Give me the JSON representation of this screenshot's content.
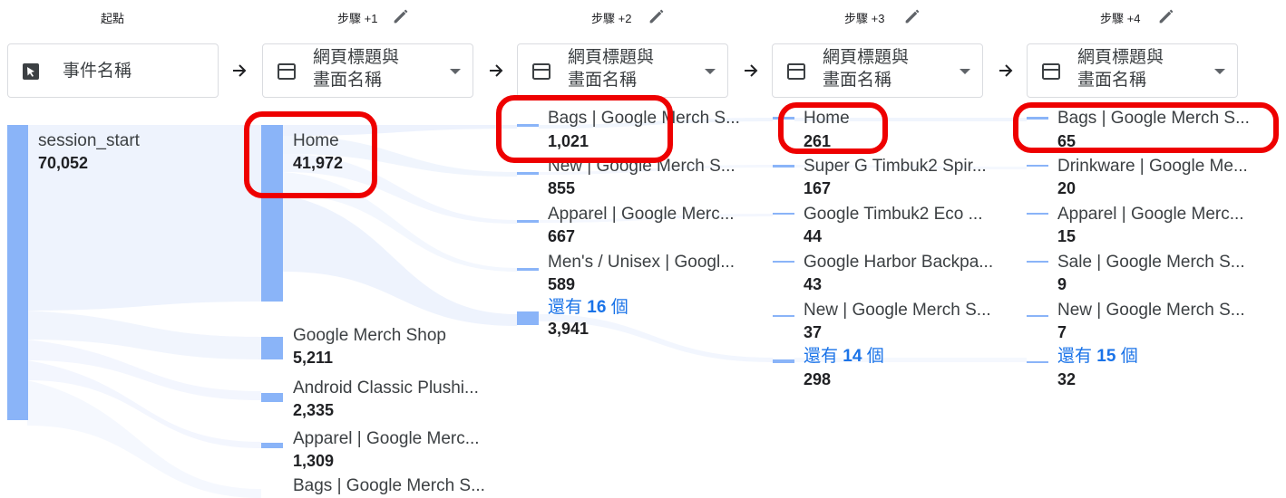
{
  "steps": [
    {
      "label": "起點"
    },
    {
      "label": "步驟 +1"
    },
    {
      "label": "步驟 +2"
    },
    {
      "label": "步驟 +3"
    },
    {
      "label": "步驟 +4"
    }
  ],
  "dropdowns": [
    {
      "line1": "事件名稱",
      "line2": ""
    },
    {
      "line1": "網頁標題與",
      "line2": "畫面名稱"
    },
    {
      "line1": "網頁標題與",
      "line2": "畫面名稱"
    },
    {
      "line1": "網頁標題與",
      "line2": "畫面名稱"
    },
    {
      "line1": "網頁標題與",
      "line2": "畫面名稱"
    }
  ],
  "col0": [
    {
      "name": "session_start",
      "value": "70,052"
    }
  ],
  "col1": [
    {
      "name": "Home",
      "value": "41,972"
    },
    {
      "name": "Google Merch Shop",
      "value": "5,211"
    },
    {
      "name": "Android Classic Plushi...",
      "value": "2,335"
    },
    {
      "name": "Apparel | Google Merc...",
      "value": "1,309"
    },
    {
      "name": "Bags | Google Merch S...",
      "value": ""
    }
  ],
  "col2": [
    {
      "name": "Bags | Google Merch S...",
      "value": "1,021"
    },
    {
      "name": "New | Google Merch S...",
      "value": "855"
    },
    {
      "name": "Apparel | Google Merc...",
      "value": "667"
    },
    {
      "name": "Men's / Unisex | Googl...",
      "value": "589"
    }
  ],
  "col2_more": {
    "prefix": "還有",
    "count": "16",
    "suffix": "個",
    "value": "3,941"
  },
  "col3": [
    {
      "name": "Home",
      "value": "261"
    },
    {
      "name": "Super G Timbuk2 Spir...",
      "value": "167"
    },
    {
      "name": "Google Timbuk2 Eco ...",
      "value": "44"
    },
    {
      "name": "Google Harbor Backpa...",
      "value": "43"
    },
    {
      "name": "New | Google Merch S...",
      "value": "37"
    }
  ],
  "col3_more": {
    "prefix": "還有",
    "count": "14",
    "suffix": "個",
    "value": "298"
  },
  "col4": [
    {
      "name": "Bags | Google Merch S...",
      "value": "65"
    },
    {
      "name": "Drinkware | Google Me...",
      "value": "20"
    },
    {
      "name": "Apparel | Google Merc...",
      "value": "15"
    },
    {
      "name": "Sale | Google Merch S...",
      "value": "9"
    },
    {
      "name": "New | Google Merch S...",
      "value": "7"
    }
  ],
  "col4_more": {
    "prefix": "還有",
    "count": "15",
    "suffix": "個",
    "value": "32"
  },
  "colors": {
    "node": "#8ab4f8",
    "link": "#1a73e8",
    "highlight": "#ee0000"
  },
  "icons": [
    "cursor-icon",
    "table-icon",
    "edit-pencil-icon",
    "arrow-right-icon",
    "caret-down-icon"
  ]
}
